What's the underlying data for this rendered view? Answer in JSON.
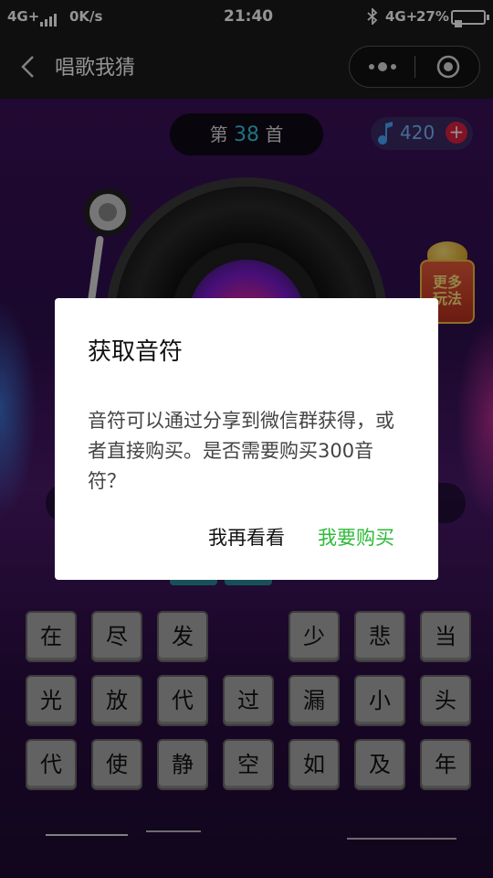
{
  "status_bar": {
    "network": "4G+",
    "speed": "0K/s",
    "time": "21:40",
    "network2": "4G+",
    "battery": "27%",
    "icons": [
      "signal-icon",
      "bluetooth-icon",
      "battery-icon"
    ]
  },
  "nav": {
    "title": "唱歌我猜",
    "back_icon": "chevron-left-icon",
    "more_icon": "more-dots-icon",
    "close_icon": "target-close-icon"
  },
  "game": {
    "round_prefix": "第",
    "round_number": "38",
    "round_suffix": "首",
    "coins": "420",
    "coins_add": "+",
    "coins_icon": "music-note-icon",
    "more_play": "更多\n玩法",
    "keyboard": {
      "row1": [
        "在",
        "尽",
        "发",
        "",
        "少",
        "悲",
        "当"
      ],
      "row2": [
        "光",
        "放",
        "代",
        "过",
        "漏",
        "小",
        "头"
      ],
      "row3": [
        "代",
        "使",
        "静",
        "空",
        "如",
        "及",
        "年"
      ]
    }
  },
  "dialog": {
    "title": "获取音符",
    "body": "音符可以通过分享到微信群获得，或者直接购买。是否需要购买300音符？",
    "cancel_label": "我再看看",
    "confirm_label": "我要购买",
    "confirm_color": "#2dba3a"
  }
}
